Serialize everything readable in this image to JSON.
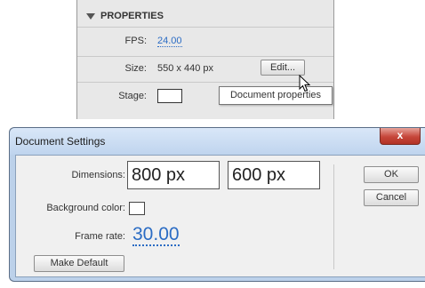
{
  "properties_panel": {
    "header": "PROPERTIES",
    "fps_label": "FPS:",
    "fps_value": "24.00",
    "size_label": "Size:",
    "size_value": "550 x 440 px",
    "edit_button": "Edit...",
    "stage_label": "Stage:",
    "stage_color": "#ffffff",
    "tooltip": "Document properties"
  },
  "dialog": {
    "title": "Document Settings",
    "close_glyph": "x",
    "dimensions_label": "Dimensions:",
    "width_value": "800 px",
    "height_value": "600 px",
    "background_color_label": "Background color:",
    "background_color": "#ffffff",
    "frame_rate_label": "Frame rate:",
    "frame_rate_value": "30.00",
    "make_default_button": "Make Default",
    "ok_button": "OK",
    "cancel_button": "Cancel"
  },
  "colors": {
    "link_blue": "#2b6cc4",
    "close_red": "#c6463a",
    "dialog_frame": "#bcd1ea"
  },
  "icons": [
    "triangle-down-icon",
    "pointer-cursor-icon",
    "close-icon"
  ]
}
